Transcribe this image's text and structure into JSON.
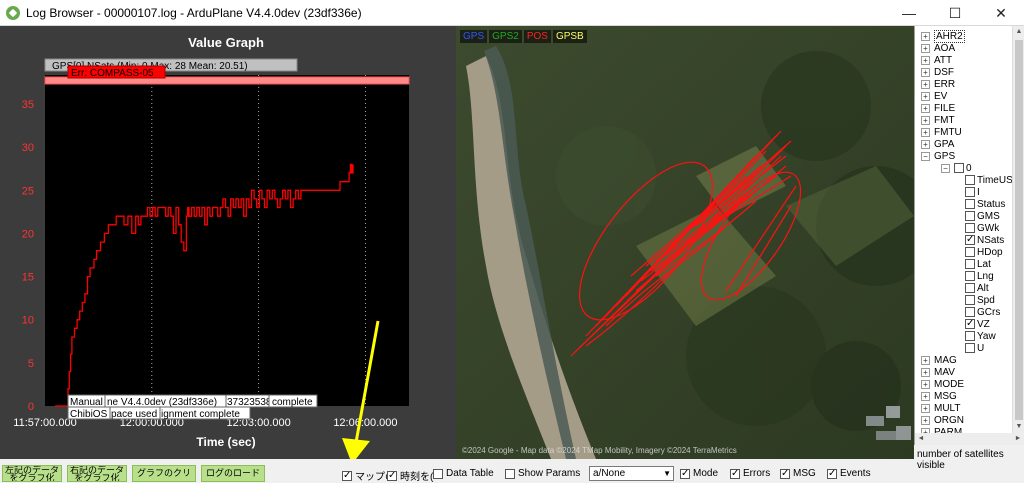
{
  "window": {
    "title": "Log Browser - 00000107.log -  ArduPlane V4.4.0dev (23df336e)",
    "minimize": "—",
    "maximize": "☐",
    "close": "✕"
  },
  "graph": {
    "title": "Value Graph",
    "xlabel": "Time (sec)",
    "legend_text": "GPS[0].NSats (Min: 0 Max: 28 Mean: 20.51)",
    "error_label": "Err: COMPASS-05",
    "msg_line1_a": "Manual",
    "msg_line1_b": "ne V4.4.0dev (23df336e)",
    "msg_line1_c": "37323538",
    "msg_line1_d": "complete",
    "msg_line2_a": "ChibiOS",
    "msg_line2_b": "pace used",
    "msg_line2_c": "ignment complete",
    "colors": {
      "background": "#3c3c3c",
      "plot": "#000000",
      "series": "#ff0000",
      "error_band": "#ff8a8a",
      "tick": "#ff3333"
    }
  },
  "chart_data": {
    "type": "line",
    "title": "Value Graph",
    "xlabel": "Time (sec)",
    "ylabel": "",
    "ylim": [
      0,
      35
    ],
    "yticks": [
      "0",
      "5",
      "10",
      "15",
      "20",
      "25",
      "30",
      "35"
    ],
    "xticks": [
      "11:57:00.000",
      "12:00:00.000",
      "12:03:00.000",
      "12:06:00.000"
    ],
    "grid": "vertical dotted",
    "legend": "top-left",
    "series": [
      {
        "name": "GPS[0].NSats",
        "x_minutes": [
          0.0,
          0.9,
          1.0,
          1.1,
          1.2,
          1.3,
          1.5,
          1.7,
          1.9,
          2.1,
          2.3,
          2.5,
          2.7,
          3.0,
          3.2,
          3.5,
          3.8,
          4.1,
          4.4,
          4.7,
          5.0,
          5.3,
          5.6,
          5.9,
          6.2,
          6.4,
          6.6,
          6.8,
          7.1,
          7.3,
          7.5,
          7.7,
          7.9,
          8.1,
          8.3,
          8.5,
          8.7,
          8.9,
          9.1,
          9.3,
          9.5,
          9.7,
          9.9,
          10.1,
          10.2,
          10.3,
          10.5,
          10.7,
          10.9,
          11.1,
          11.3,
          11.5,
          11.7,
          11.9,
          12.1,
          12.3,
          12.5,
          12.7,
          12.9,
          13.1,
          13.3,
          13.5,
          13.7,
          13.9,
          14.1,
          14.3,
          14.5,
          14.7,
          14.9,
          15.1,
          15.3,
          15.5,
          15.7,
          15.9,
          16.1,
          16.3,
          16.5,
          16.7,
          16.9,
          17.1,
          17.3,
          17.5,
          17.7,
          17.9,
          18.1,
          18.3,
          18.5,
          18.7,
          18.9,
          19.1,
          19.3,
          19.5,
          19.7,
          19.9,
          20.1,
          20.3,
          20.5,
          20.7,
          20.9,
          21.1,
          21.3,
          21.5,
          21.7,
          21.9,
          22.1,
          22.3,
          22.5,
          22.6,
          22.7,
          22.8,
          22.9
        ],
        "y": [
          0,
          0,
          2,
          4,
          6,
          8,
          9,
          10,
          11,
          12,
          13,
          15,
          16,
          17,
          18,
          19,
          20,
          21,
          21,
          22,
          22,
          21,
          22,
          20,
          22,
          21,
          22,
          22,
          23,
          22,
          23,
          22,
          23,
          23,
          23,
          22,
          23,
          22,
          20,
          23,
          21,
          19,
          18,
          22,
          23,
          22,
          23,
          22,
          23,
          22,
          23,
          21,
          23,
          22,
          23,
          23,
          22,
          23,
          24,
          23,
          22,
          24,
          23,
          24,
          23,
          24,
          22,
          24,
          23,
          25,
          24,
          23,
          25,
          24,
          23,
          25,
          24,
          25,
          24,
          23,
          24,
          25,
          24,
          25,
          23,
          24,
          25,
          24,
          25,
          25,
          25,
          25,
          25,
          25,
          25,
          25,
          25,
          25,
          25,
          25,
          25,
          25,
          25,
          26,
          26,
          26,
          26,
          27,
          28,
          27,
          28
        ]
      }
    ]
  },
  "map": {
    "legend": [
      {
        "label": "GPS",
        "color": "#3355ff"
      },
      {
        "label": "GPS2",
        "color": "#22aa22"
      },
      {
        "label": "POS",
        "color": "#ff2222"
      },
      {
        "label": "GPSB",
        "color": "#ffff66"
      }
    ],
    "credit": "©2024 Google - Map data ©2024 TMap Mobility, Imagery ©2024 TerraMetrics"
  },
  "tree": {
    "items": [
      {
        "label": "AHR2",
        "expander": "+",
        "level": 0,
        "selected": true
      },
      {
        "label": "AOA",
        "expander": "+",
        "level": 0
      },
      {
        "label": "ATT",
        "expander": "+",
        "level": 0
      },
      {
        "label": "DSF",
        "expander": "+",
        "level": 0
      },
      {
        "label": "ERR",
        "expander": "+",
        "level": 0
      },
      {
        "label": "EV",
        "expander": "+",
        "level": 0
      },
      {
        "label": "FILE",
        "expander": "+",
        "level": 0
      },
      {
        "label": "FMT",
        "expander": "+",
        "level": 0
      },
      {
        "label": "FMTU",
        "expander": "+",
        "level": 0
      },
      {
        "label": "GPA",
        "expander": "+",
        "level": 0
      },
      {
        "label": "GPS",
        "expander": "−",
        "level": 0
      },
      {
        "label": "0",
        "expander": "−",
        "level": 1,
        "checkbox": true
      },
      {
        "label": "TimeUS",
        "level": 2,
        "checkbox": true
      },
      {
        "label": "I",
        "level": 2,
        "checkbox": true
      },
      {
        "label": "Status",
        "level": 2,
        "checkbox": true
      },
      {
        "label": "GMS",
        "level": 2,
        "checkbox": true
      },
      {
        "label": "GWk",
        "level": 2,
        "checkbox": true
      },
      {
        "label": "NSats",
        "level": 2,
        "checkbox": true,
        "checked": true
      },
      {
        "label": "HDop",
        "level": 2,
        "checkbox": true
      },
      {
        "label": "Lat",
        "level": 2,
        "checkbox": true
      },
      {
        "label": "Lng",
        "level": 2,
        "checkbox": true
      },
      {
        "label": "Alt",
        "level": 2,
        "checkbox": true
      },
      {
        "label": "Spd",
        "level": 2,
        "checkbox": true
      },
      {
        "label": "GCrs",
        "level": 2,
        "checkbox": true
      },
      {
        "label": "VZ",
        "level": 2,
        "checkbox": true,
        "checked": true
      },
      {
        "label": "Yaw",
        "level": 2,
        "checkbox": true
      },
      {
        "label": "U",
        "level": 2,
        "checkbox": true
      },
      {
        "label": "MAG",
        "expander": "+",
        "level": 0
      },
      {
        "label": "MAV",
        "expander": "+",
        "level": 0
      },
      {
        "label": "MODE",
        "expander": "+",
        "level": 0
      },
      {
        "label": "MSG",
        "expander": "+",
        "level": 0
      },
      {
        "label": "MULT",
        "expander": "+",
        "level": 0
      },
      {
        "label": "ORGN",
        "expander": "+",
        "level": 0
      },
      {
        "label": "PARM",
        "expander": "+",
        "level": 0
      }
    ],
    "status": "number of satellites visible"
  },
  "toolbar": {
    "btn1_line1": "左記のデータ",
    "btn1_line2": "をグラフ化",
    "btn2_line1": "右記のデータ",
    "btn2_line2": "をグラフ化",
    "btn3": "グラフのクリア",
    "btn4": "ログのロード",
    "chk_map": "マップの",
    "chk_time": "時刻を(",
    "chk_table": "Data Table",
    "chk_params": "Show Params",
    "select_value": "a/None",
    "chk_mode": "Mode",
    "chk_errors": "Errors",
    "chk_msg": "MSG",
    "chk_events": "Events",
    "states": {
      "map": true,
      "time": true,
      "table": false,
      "params": false,
      "mode": true,
      "errors": true,
      "msg": true,
      "events": true
    }
  },
  "annotation": {
    "color": "#ffff00",
    "type": "arrow"
  }
}
